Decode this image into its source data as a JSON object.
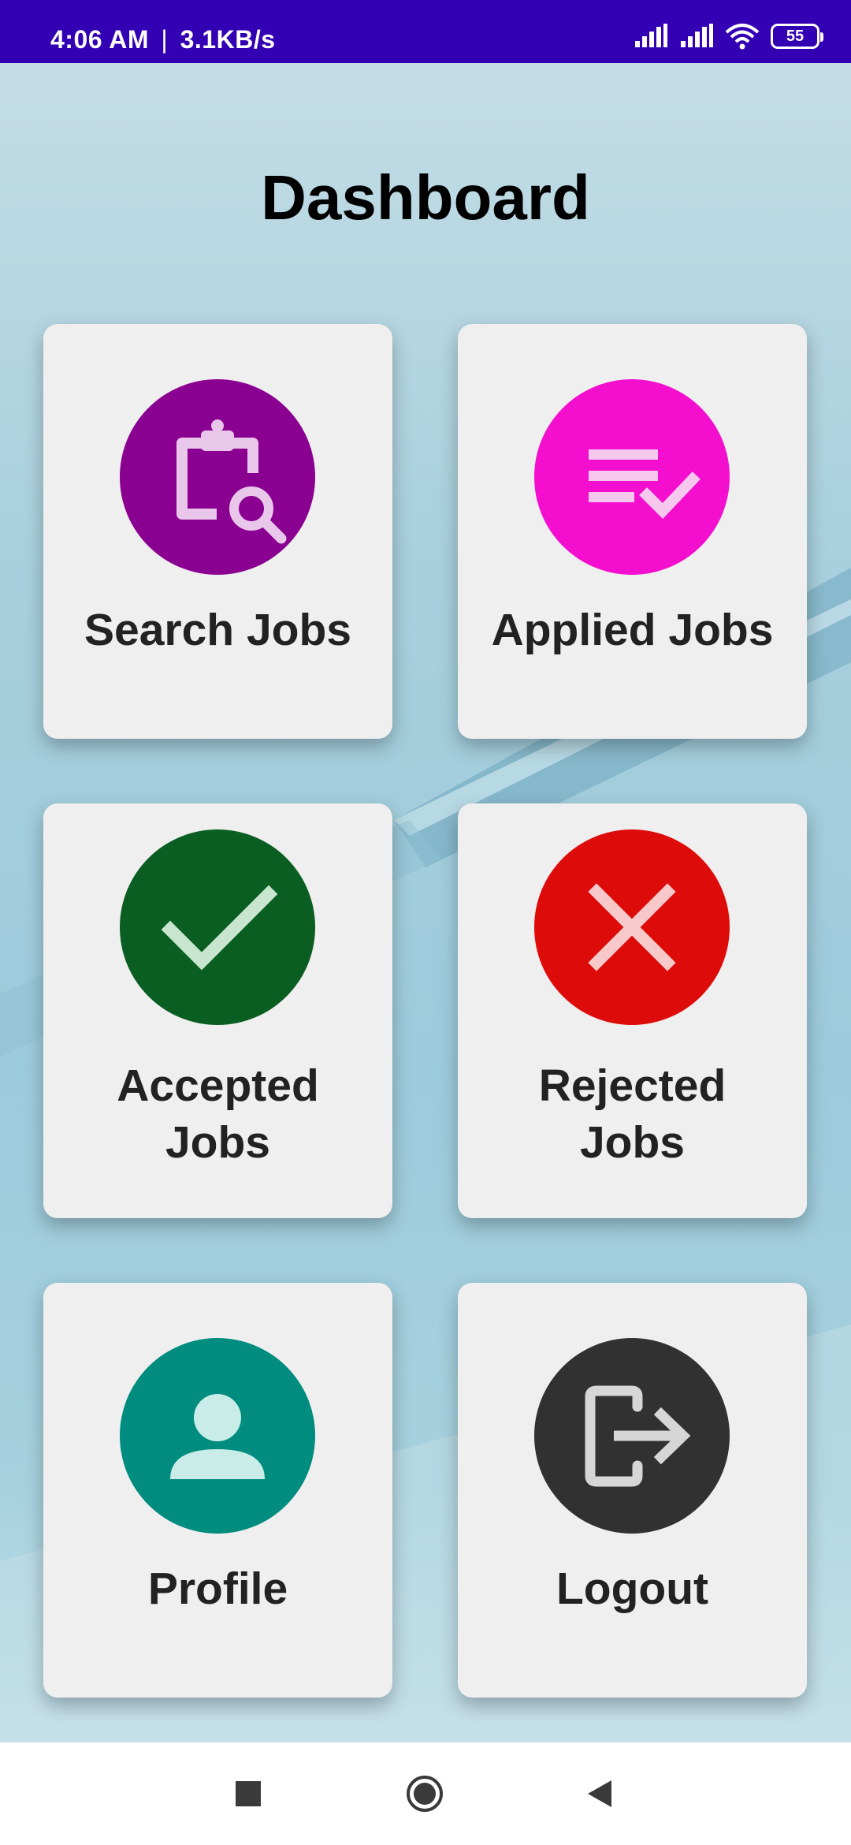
{
  "status_bar": {
    "time": "4:06 AM",
    "separator": "|",
    "speed": "3.1KB/s",
    "battery": "55",
    "icons": [
      "signal-icon",
      "signal-icon",
      "wifi-icon",
      "battery-icon"
    ]
  },
  "page": {
    "title": "Dashboard"
  },
  "tiles": [
    {
      "line1": "Search Jobs",
      "line2": "",
      "icon": "clipboard-search-icon",
      "color": "#8a0091"
    },
    {
      "line1": "Applied Jobs",
      "line2": "",
      "icon": "list-check-icon",
      "color": "#f40ece"
    },
    {
      "line1": "Accepted",
      "line2": "Jobs",
      "icon": "check-icon",
      "color": "#0b5e22"
    },
    {
      "line1": "Rejected",
      "line2": "Jobs",
      "icon": "close-icon",
      "color": "#de0b0b"
    },
    {
      "line1": "Profile",
      "line2": "",
      "icon": "person-icon",
      "color": "#008c7f"
    },
    {
      "line1": "Logout",
      "line2": "",
      "icon": "logout-icon",
      "color": "#313131"
    }
  ],
  "nav_bar": {
    "icons": [
      "recents-square-icon",
      "home-circle-icon",
      "back-triangle-icon"
    ]
  }
}
